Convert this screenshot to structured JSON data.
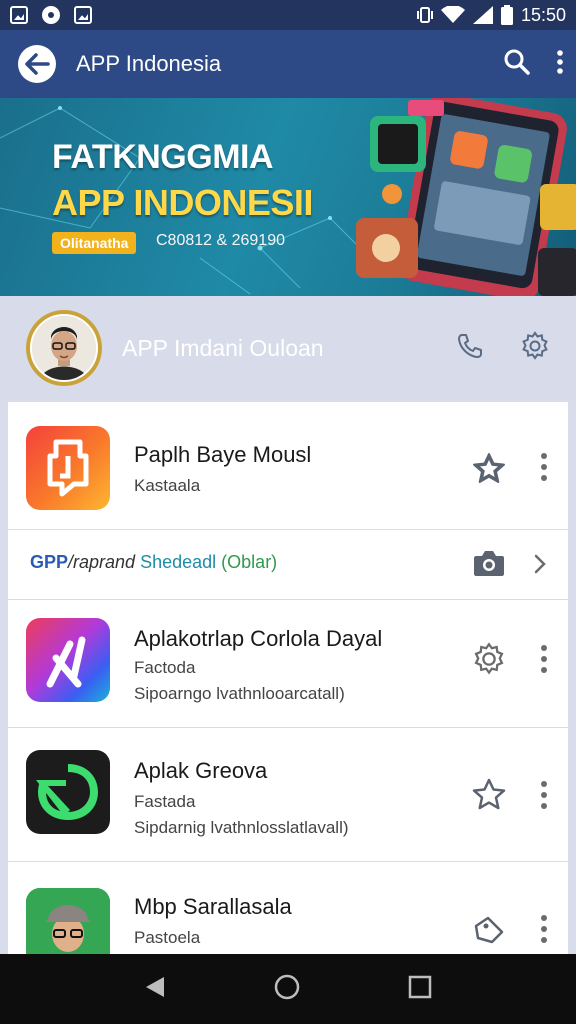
{
  "status_bar": {
    "time": "15:50"
  },
  "app_bar": {
    "title": "APP Indonesia",
    "back_icon": "arrow-left-icon",
    "search_icon": "search-icon",
    "more_icon": "more-vert-icon"
  },
  "banner": {
    "title_line1": "FATKNGGMIA",
    "title_line2": "APP INDONESII",
    "badge": "Olitanatha",
    "subtitle": "C80812 & 269190"
  },
  "profile": {
    "name": "APP Imdani Ouloan",
    "phone_icon": "phone-icon",
    "settings_icon": "gear-icon"
  },
  "promo": {
    "part1": "GPP",
    "part2": "/raprand",
    "part3": "Shedeadl",
    "part4": "(Oblar)"
  },
  "apps": [
    {
      "title": "Paplh Baye Mousl",
      "subtitle": "Kastaala",
      "detail": "",
      "action_icon": "star-icon"
    },
    {
      "title": "Aplakotrlap Corlola Dayal",
      "subtitle": "Factoda",
      "detail": "Sipoarngo lvathnlooarcatall)",
      "action_icon": "gear-icon"
    },
    {
      "title": "Aplak Greova",
      "subtitle": "Fastada",
      "detail": "Sipdarnig lvathnlosslatlavall)",
      "action_icon": "star-icon"
    },
    {
      "title": "Mbp Sarallasala",
      "subtitle": "Pastoela",
      "detail": "",
      "action_icon": "tag-icon"
    }
  ],
  "colors": {
    "status_bar": "#23355f",
    "app_bar": "#2e4a86",
    "accent_yellow": "#ffd84a",
    "profile_bg": "#d8dbe9"
  }
}
